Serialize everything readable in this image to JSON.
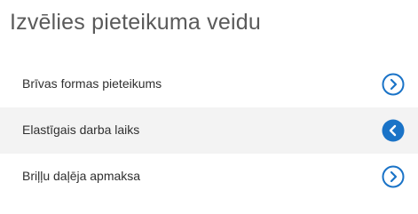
{
  "panel": {
    "title": "Izvēlies pieteikuma veidu"
  },
  "options": [
    {
      "label": "Brīvas formas pieteikums",
      "icon": "chevron-right-circle-icon",
      "selected": false
    },
    {
      "label": "Elastīgais darba laiks",
      "icon": "chevron-left-circle-filled-icon",
      "selected": true
    },
    {
      "label": "Briļļu daļēja apmaksa",
      "icon": "chevron-right-circle-icon",
      "selected": false
    }
  ],
  "colors": {
    "accent": "#1a73c7",
    "selected_bg": "#f3f3f3",
    "title_text": "#5a5a5a"
  }
}
